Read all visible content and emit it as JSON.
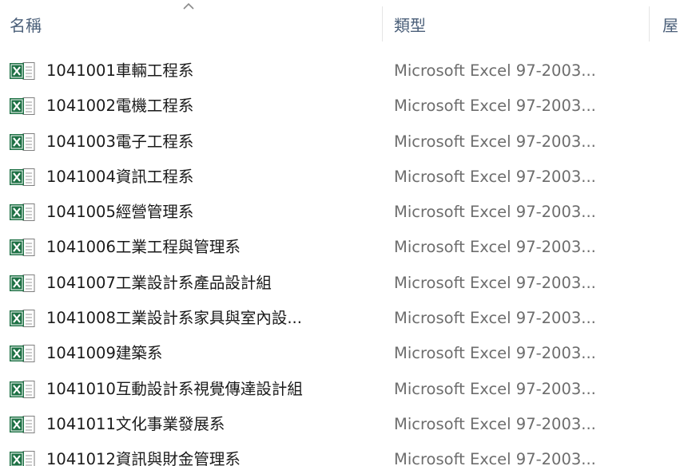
{
  "columns": {
    "name": "名稱",
    "type": "類型",
    "size": "屋"
  },
  "sort": {
    "column": "name",
    "direction": "ascending",
    "icon": "sort-up-chevron"
  },
  "row_icon": "excel-file-icon",
  "colors": {
    "excel_green": "#1e7145",
    "header_text": "#4c607a",
    "name_text": "#1a1a1a",
    "type_text": "#6d6d6d"
  },
  "files": [
    {
      "name": "1041001車輛工程系",
      "type": "Microsoft Excel 97-2003..."
    },
    {
      "name": "1041002電機工程系",
      "type": "Microsoft Excel 97-2003..."
    },
    {
      "name": "1041003電子工程系",
      "type": "Microsoft Excel 97-2003..."
    },
    {
      "name": "1041004資訊工程系",
      "type": "Microsoft Excel 97-2003..."
    },
    {
      "name": "1041005經營管理系",
      "type": "Microsoft Excel 97-2003..."
    },
    {
      "name": "1041006工業工程與管理系",
      "type": "Microsoft Excel 97-2003..."
    },
    {
      "name": "1041007工業設計系產品設計組",
      "type": "Microsoft Excel 97-2003..."
    },
    {
      "name": "1041008工業設計系家具與室內設...",
      "type": "Microsoft Excel 97-2003..."
    },
    {
      "name": "1041009建築系",
      "type": "Microsoft Excel 97-2003..."
    },
    {
      "name": "1041010互動設計系視覺傳達設計組",
      "type": "Microsoft Excel 97-2003..."
    },
    {
      "name": "1041011文化事業發展系",
      "type": "Microsoft Excel 97-2003..."
    },
    {
      "name": "1041012資訊與財金管理系",
      "type": "Microsoft Excel 97-2003..."
    }
  ]
}
